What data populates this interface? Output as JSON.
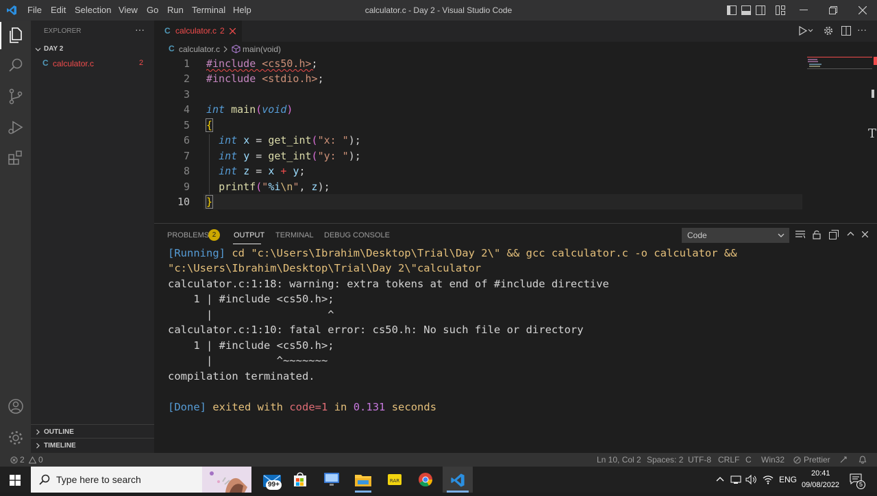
{
  "titlebar": {
    "menu": [
      "File",
      "Edit",
      "Selection",
      "View",
      "Go",
      "Run",
      "Terminal",
      "Help"
    ],
    "title": "calculator.c - Day 2 - Visual Studio Code"
  },
  "sidebar": {
    "explorer_label": "EXPLORER",
    "folder_name": "DAY 2",
    "file_name": "calculator.c",
    "file_problems": "2",
    "outline_label": "OUTLINE",
    "timeline_label": "TIMELINE"
  },
  "tab": {
    "label": "calculator.c",
    "problems": "2"
  },
  "breadcrumb": {
    "file": "calculator.c",
    "symbol": "main(void)"
  },
  "editor": {
    "line_numbers": [
      "1",
      "2",
      "3",
      "4",
      "5",
      "6",
      "7",
      "8",
      "9",
      "10"
    ],
    "lines": {
      "l1_directive": "#include",
      "l1_header": "<cs50.h>",
      "l1_end": ";",
      "l2_directive": "#include",
      "l2_header": "<stdio.h>",
      "l2_end": ";",
      "l4_type": "int",
      "l4_name": "main",
      "l4_open": "(",
      "l4_param": "void",
      "l4_close": ")",
      "l5": "{",
      "l6_type": "int",
      "l6_var": "x",
      "l6_eq": "=",
      "l6_fn": "get_int",
      "l6_open": "(",
      "l6_str": "\"x: \"",
      "l6_close": ");",
      "l7_type": "int",
      "l7_var": "y",
      "l7_eq": "=",
      "l7_fn": "get_int",
      "l7_open": "(",
      "l7_str": "\"y: \"",
      "l7_close": ");",
      "l8_type": "int",
      "l8_var": "z",
      "l8_eq": "=",
      "l8_a": "x",
      "l8_plus": "+",
      "l8_b": "y",
      "l8_end": ";",
      "l9_fn": "printf",
      "l9_open": "(",
      "l9_str1": "\"",
      "l9_fmt": "%i",
      "l9_esc": "\\n",
      "l9_str2": "\"",
      "l9_comma": ",",
      "l9_var": "z",
      "l9_close": ");",
      "l10": "}"
    }
  },
  "panel": {
    "tabs": {
      "problems": "PROBLEMS",
      "problems_count": "2",
      "output": "OUTPUT",
      "terminal": "TERMINAL",
      "debug": "DEBUG CONSOLE"
    },
    "channel": "Code",
    "output": {
      "running_tag": "[Running]",
      "cmd_line1": "cd \"c:\\Users\\Ibrahim\\Desktop\\Trial\\Day 2\\\" && gcc calculator.c -o calculator &&",
      "cmd_line2": "\"c:\\Users\\Ibrahim\\Desktop\\Trial\\Day 2\\\"calculator",
      "warn": "calculator.c:1:18: warning: extra tokens at end of #include directive",
      "warn_src": "    1 | #include <cs50.h>;",
      "warn_caret": "      |                  ^",
      "fatal": "calculator.c:1:10: fatal error: cs50.h: No such file or directory",
      "fatal_src": "    1 | #include <cs50.h>;",
      "fatal_caret": "      |          ^~~~~~~~",
      "terminated": "compilation terminated.",
      "done_tag": "[Done]",
      "exited": "exited with",
      "code": "code=1",
      "in": "in",
      "seconds_val": "0.131",
      "seconds": "seconds"
    }
  },
  "statusbar": {
    "errors": "2",
    "warnings": "0",
    "position": "Ln 10, Col 2",
    "spaces": "Spaces: 2",
    "encoding": "UTF-8",
    "eol": "CRLF",
    "language": "C",
    "platform": "Win32",
    "formatter": "Prettier"
  },
  "taskbar": {
    "search_placeholder": "Type here to search",
    "mail_badge": "99+",
    "language": "ENG",
    "time": "20:41",
    "date": "09/08/2022",
    "notifications": "5"
  }
}
